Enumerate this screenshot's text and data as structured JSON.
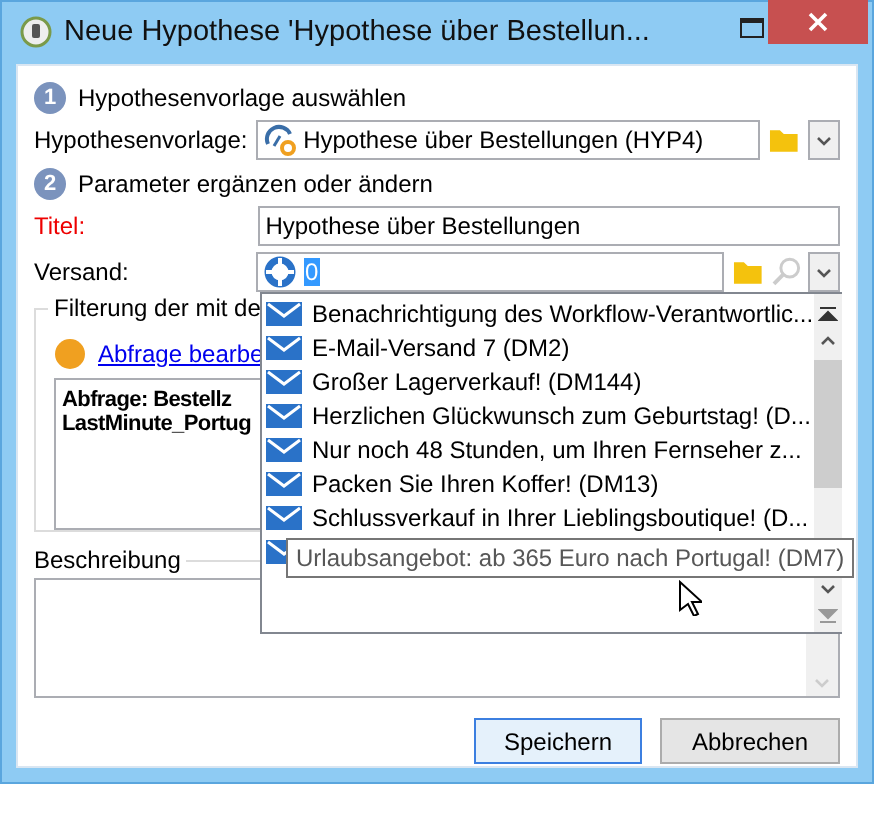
{
  "window": {
    "title": "Neue Hypothese 'Hypothese über Bestellun..."
  },
  "step1": {
    "number": "1",
    "label": "Hypothesenvorlage auswählen"
  },
  "template_field": {
    "label": "Hypothesenvorlage:",
    "value": "Hypothese über Bestellungen (HYP4)"
  },
  "step2": {
    "number": "2",
    "label": "Parameter ergänzen oder ändern"
  },
  "title_field": {
    "label": "Titel:",
    "required": true,
    "value": "Hypothese über Bestellungen"
  },
  "delivery_field": {
    "label": "Versand:",
    "value": "0"
  },
  "filter_group": {
    "legend": "Filterung der mit de",
    "link": "Abfrage bearbe",
    "query_lines": [
      "Abfrage: Bestellz",
      "LastMinute_Portug"
    ]
  },
  "dropdown": {
    "items": [
      {
        "label": "Benachrichtigung des Workflow-Verantwortlic..."
      },
      {
        "label": "E-Mail-Versand  7 (DM2)"
      },
      {
        "label": "Großer Lagerverkauf! (DM144)"
      },
      {
        "label": "Herzlichen Glückwunsch zum Geburtstag! (D..."
      },
      {
        "label": "Nur noch 48 Stunden, um Ihren Fernseher z..."
      },
      {
        "label": "Packen Sie Ihren Koffer! (DM13)"
      },
      {
        "label": "Schlussverkauf in Ihrer Lieblingsboutique! (D..."
      }
    ]
  },
  "tooltip": {
    "text": "Urlaubsangebot: ab 365 Euro nach Portugal! (DM7)"
  },
  "description": {
    "label": "Beschreibung"
  },
  "buttons": [
    {
      "label": "Speichern",
      "default": true
    },
    {
      "label": "Abbrechen",
      "default": false
    }
  ]
}
